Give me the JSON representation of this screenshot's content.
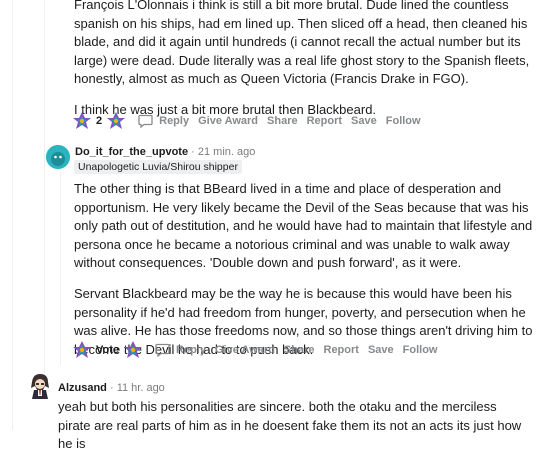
{
  "comment1": {
    "paragraph1": "François L'Olonnais i think is still a bit more brutal. Dude lined the countless spanish on his ships, had em lined up. Then sliced off a head, then cleaned his blade, and did it again until hundreds (i cannot recall the actual number but its large) were dead. Dude literally was a real life ghost story to the Spanish fleets, honestly, almost as much as Queen Victoria (Francis Drake in FGO).",
    "paragraph2": "I think he was just a bit more brutal then Blackbeard.",
    "vote_count": "2"
  },
  "comment2": {
    "username": "Do_it_for_the_upvote",
    "time": "· 21 min. ago",
    "flair": "Unapologetic Luvia/Shirou shipper",
    "paragraph1": "The other thing is that BBeard lived in a time and place of desperation and opportunism. He very likely became the Devil of the Seas because that was his only path out of destitution, and he would have had to maintain that lifestyle and persona once he became a notorious criminal and was unable to walk away without consequences. 'Double down and push forward', as it were.",
    "paragraph2": "Servant Blackbeard may be the way he is because this would have been his personality if he'd had freedom from hunger, poverty, and persecution when he was alive. He has those freedoms now, and so those things aren't driving him to become the Devil he had to to push back.",
    "vote_label": "Vote"
  },
  "comment3": {
    "username": "Alzusand",
    "time": "· 11 hr. ago",
    "paragraph1": "yeah but both his personalities are sincere. both the otaku and the merciless pirate are real parts of him as in he doesent fake them its not an acts its just how he is"
  },
  "actions": {
    "reply": "Reply",
    "give_award": "Give Award",
    "share": "Share",
    "report": "Report",
    "save": "Save",
    "follow": "Follow"
  },
  "icons": {
    "upvote": "upvote-award-icon",
    "downvote": "downvote-award-icon",
    "reply": "reply-icon",
    "avatar1": "avatar-blue-icon",
    "avatar2": "avatar-character-icon"
  },
  "colors": {
    "award_purple": "#7e53c1",
    "award_teal": "#24a0a9",
    "award_yellow": "#f4b400",
    "muted": "#878a8c",
    "flair_bg": "#edeff1",
    "avatar_teal": "#2bb3c0"
  }
}
